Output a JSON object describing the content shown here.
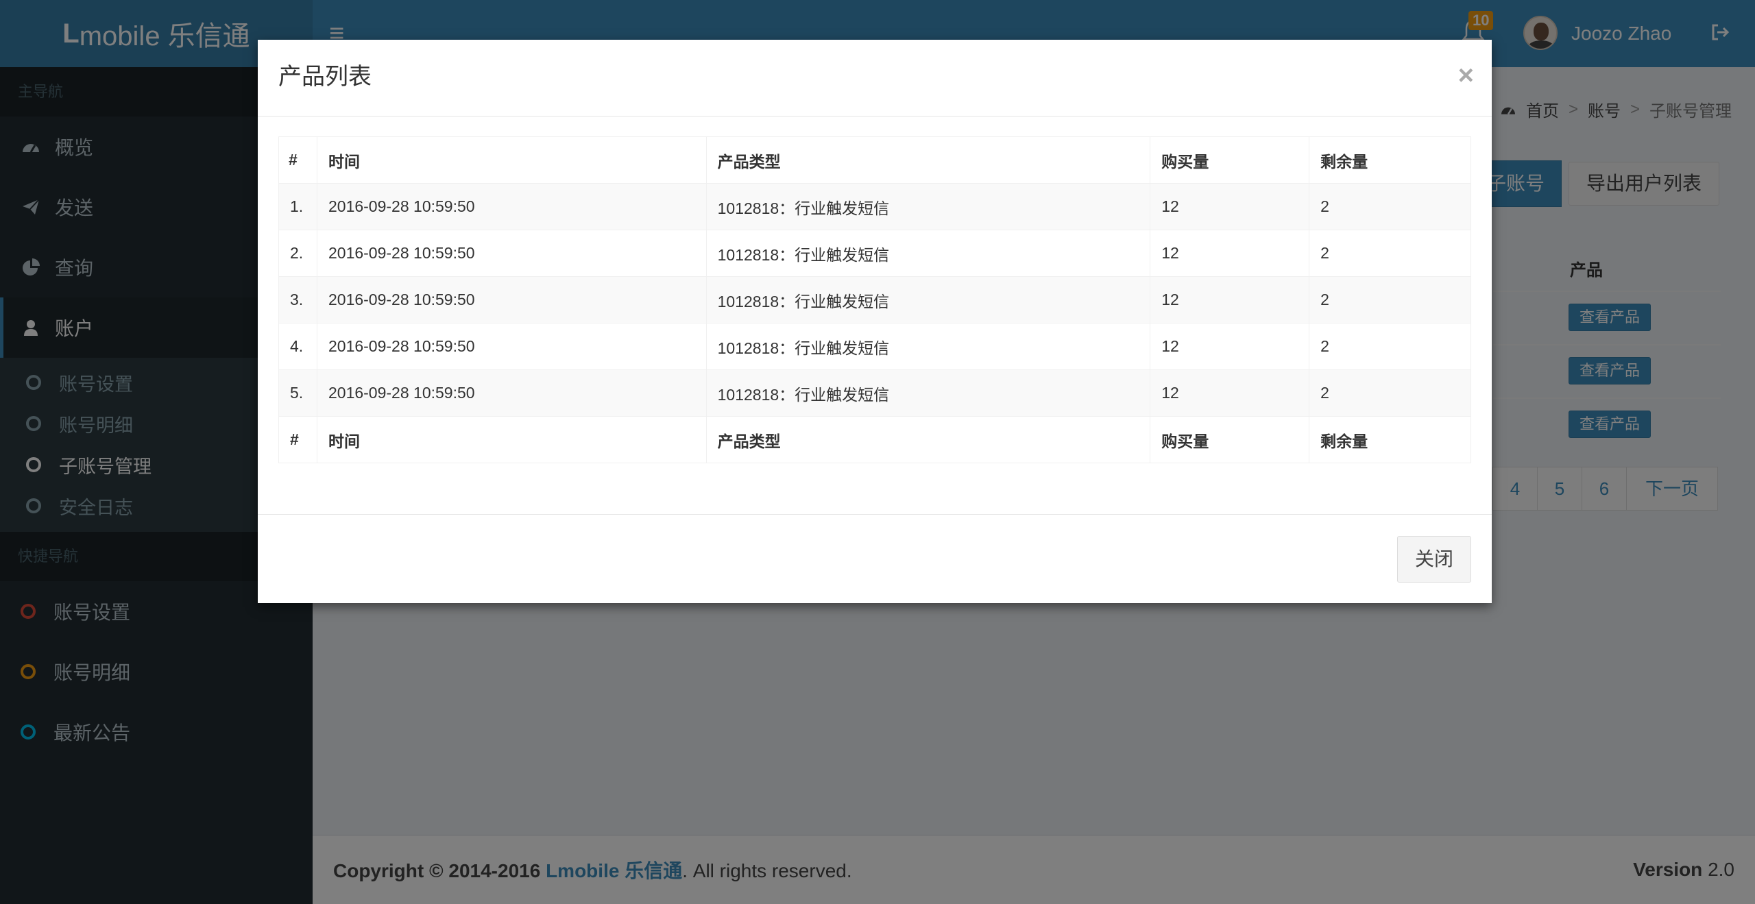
{
  "header": {
    "logo_bold": "L",
    "logo_rest": "mobile 乐信通",
    "notification_count": "10",
    "user_name": "Joozo Zhao"
  },
  "sidebar": {
    "main_nav_header": "主导航",
    "items": [
      {
        "label": "概览",
        "icon": "dashboard-icon"
      },
      {
        "label": "发送",
        "icon": "paper-plane-icon"
      },
      {
        "label": "查询",
        "icon": "pie-chart-icon"
      },
      {
        "label": "账户",
        "icon": "user-icon"
      }
    ],
    "sub_items": [
      {
        "label": "账号设置"
      },
      {
        "label": "账号明细"
      },
      {
        "label": "子账号管理"
      },
      {
        "label": "安全日志"
      }
    ],
    "quick_nav_header": "快捷导航",
    "quick_items": [
      {
        "label": "账号设置",
        "color": "#dd4b39"
      },
      {
        "label": "账号明细",
        "color": "#f39c12"
      },
      {
        "label": "最新公告",
        "color": "#00c0ef"
      }
    ]
  },
  "breadcrumb": {
    "home": "首页",
    "account": "账号",
    "current": "子账号管理"
  },
  "background_page": {
    "add_button_partial": "子账号",
    "export_button": "导出用户列表",
    "product_column": "产品",
    "view_product_button": "查看产品",
    "pager": [
      "4",
      "5",
      "6",
      "下一页"
    ]
  },
  "modal": {
    "title": "产品列表",
    "close_x": "×",
    "columns": [
      "#",
      "时间",
      "产品类型",
      "购买量",
      "剩余量"
    ],
    "rows": [
      {
        "idx": "1.",
        "time": "2016-09-28 10:59:50",
        "type": "1012818：行业触发短信",
        "bought": "12",
        "remaining": "2"
      },
      {
        "idx": "2.",
        "time": "2016-09-28 10:59:50",
        "type": "1012818：行业触发短信",
        "bought": "12",
        "remaining": "2"
      },
      {
        "idx": "3.",
        "time": "2016-09-28 10:59:50",
        "type": "1012818：行业触发短信",
        "bought": "12",
        "remaining": "2"
      },
      {
        "idx": "4.",
        "time": "2016-09-28 10:59:50",
        "type": "1012818：行业触发短信",
        "bought": "12",
        "remaining": "2"
      },
      {
        "idx": "5.",
        "time": "2016-09-28 10:59:50",
        "type": "1012818：行业触发短信",
        "bought": "12",
        "remaining": "2"
      }
    ],
    "close_button": "关闭"
  },
  "footer": {
    "copyright_prefix": "Copyright © 2014-2016 ",
    "brand": "Lmobile 乐信通",
    "suffix": ". All rights reserved.",
    "version_label": "Version",
    "version_value": " 2.0"
  }
}
